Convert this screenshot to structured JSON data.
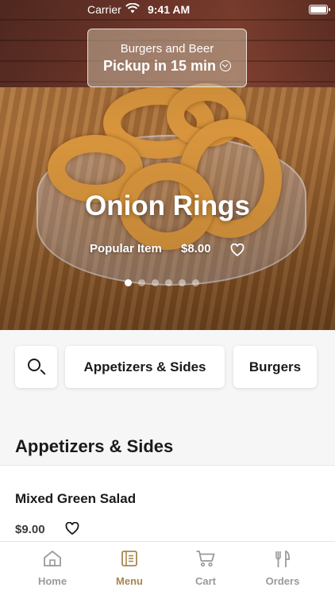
{
  "status_bar": {
    "carrier": "Carrier",
    "time": "9:41 AM"
  },
  "location": {
    "name": "Burgers and Beer",
    "pickup": "Pickup in 15 min"
  },
  "hero": {
    "title": "Onion Rings",
    "tag": "Popular Item",
    "price": "$8.00",
    "carousel": {
      "count": 6,
      "active": 1
    }
  },
  "categories": {
    "search_icon": "search-icon",
    "items": [
      "Appetizers & Sides",
      "Burgers"
    ]
  },
  "section": {
    "title": "Appetizers & Sides"
  },
  "menu_items": [
    {
      "name": "Mixed Green Salad",
      "price": "$9.00"
    }
  ],
  "tab_bar": {
    "tabs": [
      {
        "label": "Home",
        "icon": "home-icon"
      },
      {
        "label": "Menu",
        "icon": "menu-icon"
      },
      {
        "label": "Cart",
        "icon": "cart-icon"
      },
      {
        "label": "Orders",
        "icon": "fork-knife-icon"
      }
    ],
    "active": "Menu"
  },
  "colors": {
    "accent": "#a7864e",
    "inactive": "#9a9a9a"
  }
}
